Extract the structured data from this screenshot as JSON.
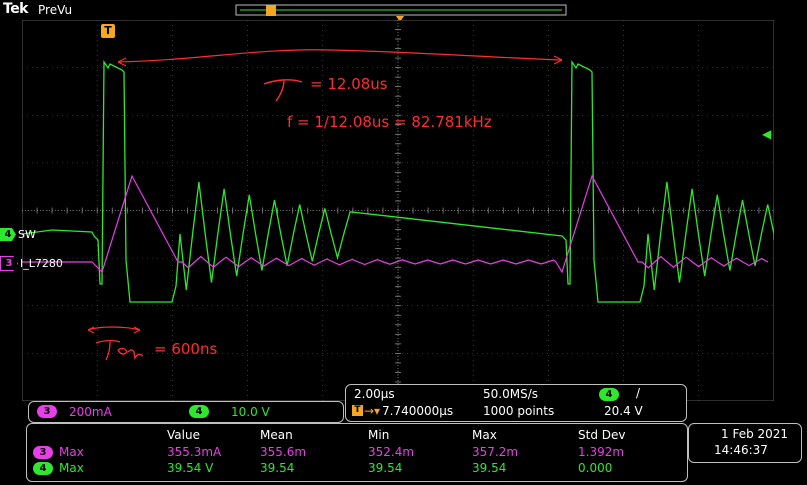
{
  "header": {
    "brand": "Tek",
    "mode": "PreVu"
  },
  "trigger_marker": "T",
  "channels": [
    {
      "num": "4",
      "name": "SW",
      "color": "#2ee82e"
    },
    {
      "num": "3",
      "name": "I_L7280",
      "color": "#e83fe8"
    }
  ],
  "annotations": {
    "period": "= 12.08us",
    "frequency": "f = 1/12.08us = 82.781kHz",
    "ton": "= 600ns"
  },
  "scale_panel": {
    "ch3_num": "3",
    "ch3_scale": "200mA",
    "ch4_num": "4",
    "ch4_scale": "10.0 V"
  },
  "timebase": {
    "time_div": "2.00µs",
    "sample_rate": "50.0MS/s",
    "trig_pos": "7.740000µs",
    "record": "1000 points",
    "trig_ch": "4",
    "trig_slope": "/",
    "trig_level": "20.4 V"
  },
  "measurements": {
    "headers": [
      "Value",
      "Mean",
      "Min",
      "Max",
      "Std Dev"
    ],
    "rows": [
      {
        "ch": "3",
        "type": "Max",
        "value": "355.3mA",
        "mean": "355.6m",
        "min": "352.4m",
        "max": "357.2m",
        "std": "1.392m",
        "color": "#e83fe8"
      },
      {
        "ch": "4",
        "type": "Max",
        "value": "39.54 V",
        "mean": "39.54",
        "min": "39.54",
        "max": "39.54",
        "std": "0.000",
        "color": "#2ee82e"
      }
    ]
  },
  "datetime": {
    "date": "1 Feb 2021",
    "time": "14:46:37"
  },
  "colors": {
    "ch4": "#2ee82e",
    "ch3": "#e83fe8",
    "trigger": "#f5a623",
    "annotation": "#ff2d2d",
    "grid": "#5a5a5a"
  }
}
